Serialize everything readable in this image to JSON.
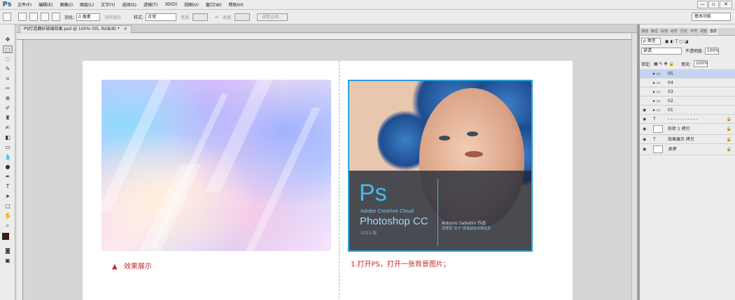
{
  "menu": {
    "logo": "Ps",
    "items": [
      "文件(F)",
      "编辑(E)",
      "图像(I)",
      "图层(L)",
      "文字(Y)",
      "选择(S)",
      "滤镜(T)",
      "3D(D)",
      "视图(V)",
      "窗口(W)",
      "帮助(H)"
    ],
    "window_controls": [
      "—",
      "▫",
      "✕"
    ]
  },
  "options": {
    "feather_label": "羽化:",
    "feather_value": "0 像素",
    "antialias": "消除锯齿",
    "style_label": "样式:",
    "style_value": "正常",
    "width_label": "宽度:",
    "height_label": "高度:",
    "refine_button": "调整边缘...",
    "workspace": "基本功能"
  },
  "document": {
    "tab_title": "PS打造磨砂玻璃效果.psd @ 100% (05, RGB/8) *",
    "tab_close": "×"
  },
  "canvas": {
    "caption_left_marker": "▲",
    "caption_left": "效果展示",
    "caption_right": "1.打开PS，打开一张背景图片；",
    "ps_splash": {
      "logo": "Ps",
      "adobe": "Adobe Creative Cloud",
      "product": "Photoshop CC",
      "year": "2015 版",
      "credit": "Antonio Sabatini 作品",
      "credit2": "请查看“关于”屏幕获取详细信息"
    }
  },
  "panel": {
    "tabs": [
      "通道",
      "路径",
      "段落",
      "动作",
      "历史",
      "字符",
      "调整",
      "图层"
    ],
    "filter_kind": "ρ 类型",
    "blend_mode": "穿透",
    "opacity_label": "不透明度:",
    "opacity_value": "100%",
    "lock_label": "锁定:",
    "fill_label": "填充:",
    "fill_value": "100%",
    "layers": [
      {
        "name": "05",
        "type": "group",
        "visible": false,
        "selected": true
      },
      {
        "name": "04",
        "type": "group",
        "visible": false,
        "selected": false
      },
      {
        "name": "03",
        "type": "group",
        "visible": false,
        "selected": false
      },
      {
        "name": "02",
        "type": "group",
        "visible": false,
        "selected": false
      },
      {
        "name": "01",
        "type": "group",
        "visible": true,
        "selected": false
      },
      {
        "name": "- - - - - - - - - - -",
        "type": "text",
        "visible": true,
        "selected": false
      },
      {
        "name": "形状 1 拷贝",
        "type": "shape",
        "visible": true,
        "selected": false
      },
      {
        "name": "效果展示 拷贝",
        "type": "text",
        "visible": true,
        "selected": false
      },
      {
        "name": "背景",
        "type": "background",
        "visible": true,
        "selected": false
      }
    ]
  },
  "colors": {
    "caption": "#c62828",
    "accent": "#2b9fd6",
    "selection": "#c3d5ef"
  }
}
